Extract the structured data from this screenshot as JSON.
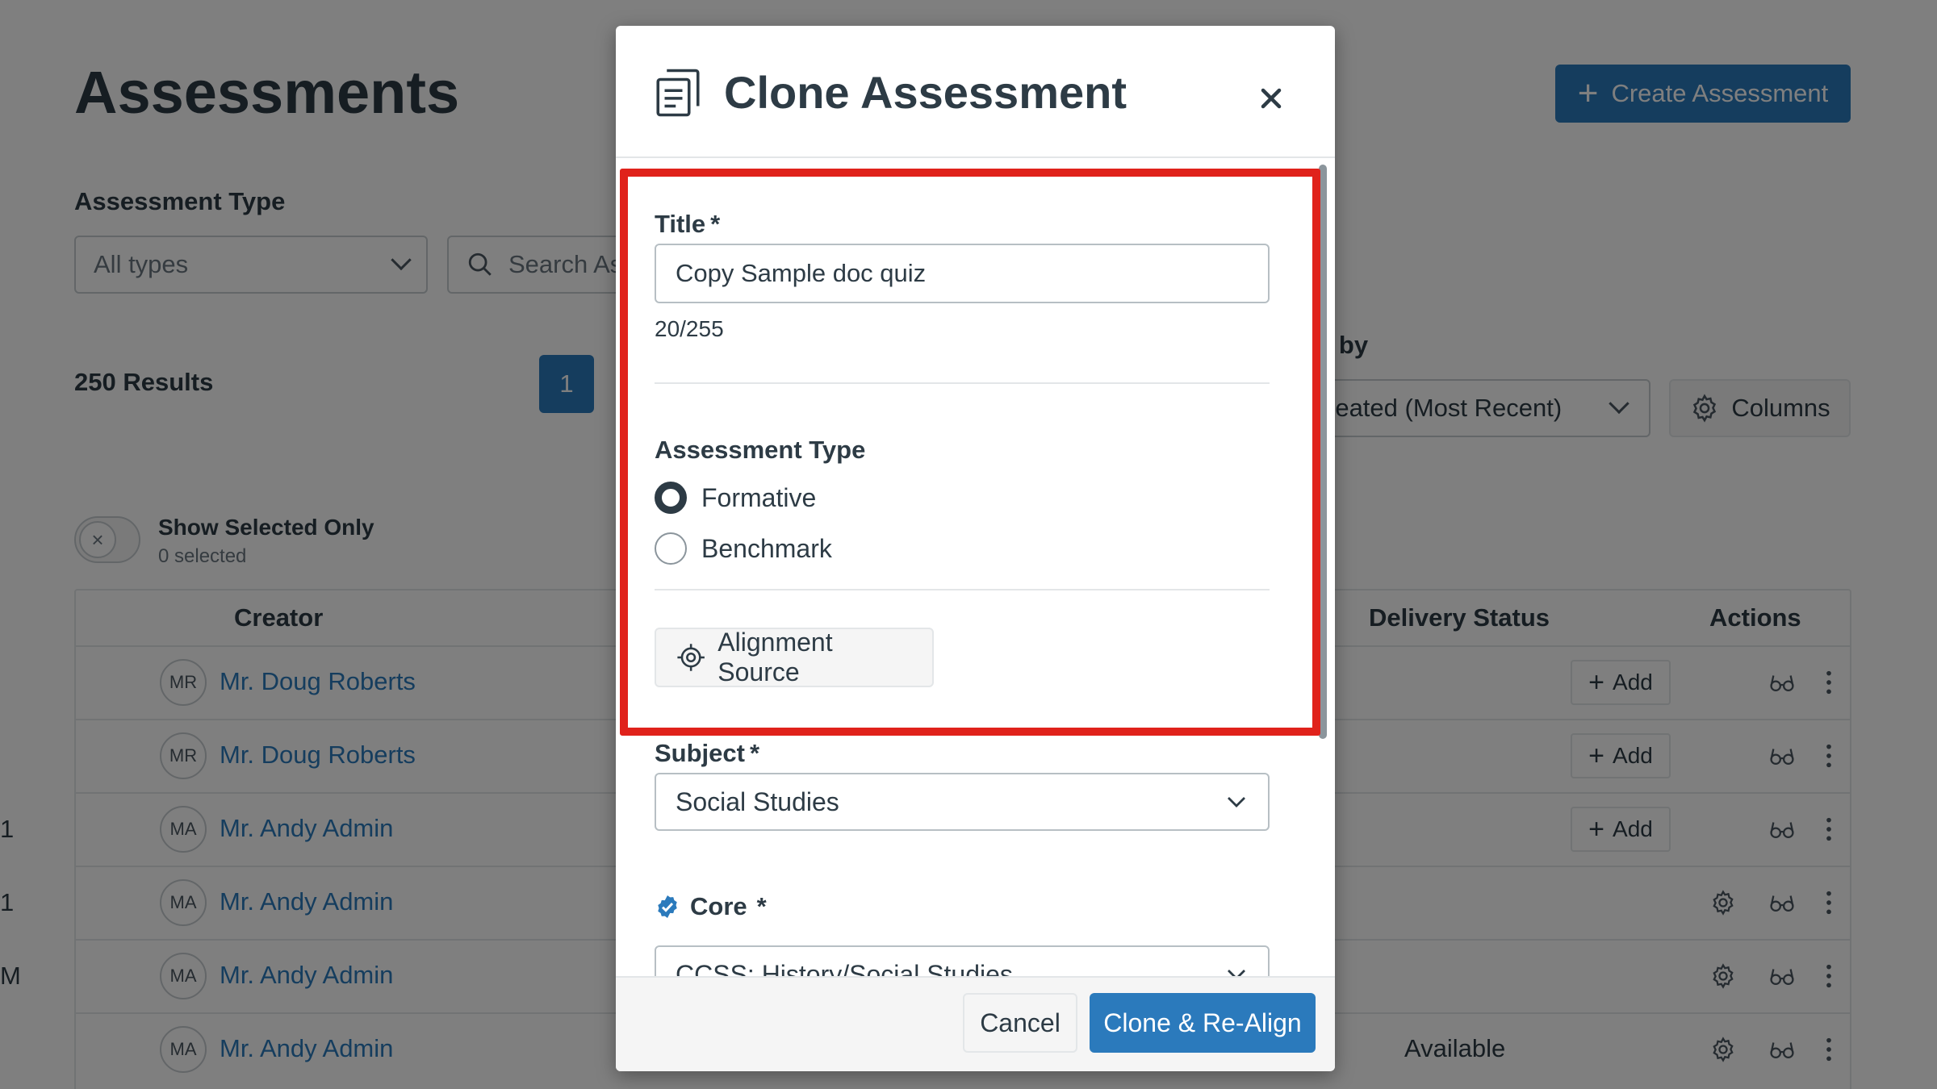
{
  "background": {
    "page_title": "Assessments",
    "create_button_label": "Create Assessment",
    "assessment_type_label": "Assessment Type",
    "type_filter_value": "All types",
    "search_placeholder": "Search As",
    "results_count": "250 Results",
    "current_page": "1",
    "sort_label": "t by",
    "sort_value": "reated (Most Recent)",
    "columns_button_label": "Columns",
    "toggle_icon": "×",
    "show_selected_label": "Show Selected Only",
    "selected_count": "0 selected",
    "table": {
      "headers": {
        "creator": "Creator",
        "delivery": "Delivery Status",
        "actions": "Actions"
      },
      "add_label": "Add",
      "rows": [
        {
          "edge": "",
          "initials": "MR",
          "creator": "Mr. Doug Roberts",
          "delivery": "",
          "action": "add"
        },
        {
          "edge": "",
          "initials": "MR",
          "creator": "Mr. Doug Roberts",
          "delivery": "",
          "action": "add"
        },
        {
          "edge": "1",
          "initials": "MA",
          "creator": "Mr. Andy Admin",
          "delivery": "",
          "action": "add"
        },
        {
          "edge": "1",
          "initials": "MA",
          "creator": "Mr. Andy Admin",
          "delivery": "",
          "action": "gear"
        },
        {
          "edge": "M",
          "initials": "MA",
          "creator": "Mr. Andy Admin",
          "delivery": "",
          "action": "gear"
        },
        {
          "edge": "",
          "initials": "MA",
          "creator": "Mr. Andy Admin",
          "delivery": "Available",
          "action": "gear"
        }
      ]
    }
  },
  "modal": {
    "title": "Clone Assessment",
    "close_icon": "close-icon",
    "fields": {
      "title_label": "Title",
      "required_mark": "*",
      "title_value": "Copy Sample doc quiz",
      "char_count": "20/255",
      "assessment_type_label": "Assessment Type",
      "type_options": [
        {
          "label": "Formative",
          "checked": true
        },
        {
          "label": "Benchmark",
          "checked": false
        }
      ],
      "alignment_source_label": "Alignment Source",
      "subject_label": "Subject",
      "subject_value": "Social Studies",
      "core_label": "Core",
      "core_value": "CCSS: History/Social Studies"
    },
    "footer": {
      "cancel_label": "Cancel",
      "clone_label": "Clone & Re-Align"
    }
  },
  "colors": {
    "accent_blue": "#2b7abc",
    "highlight_red": "#e0221b",
    "text_dark": "#2d3b45",
    "overlay": "rgba(0,0,0,0.5)"
  }
}
